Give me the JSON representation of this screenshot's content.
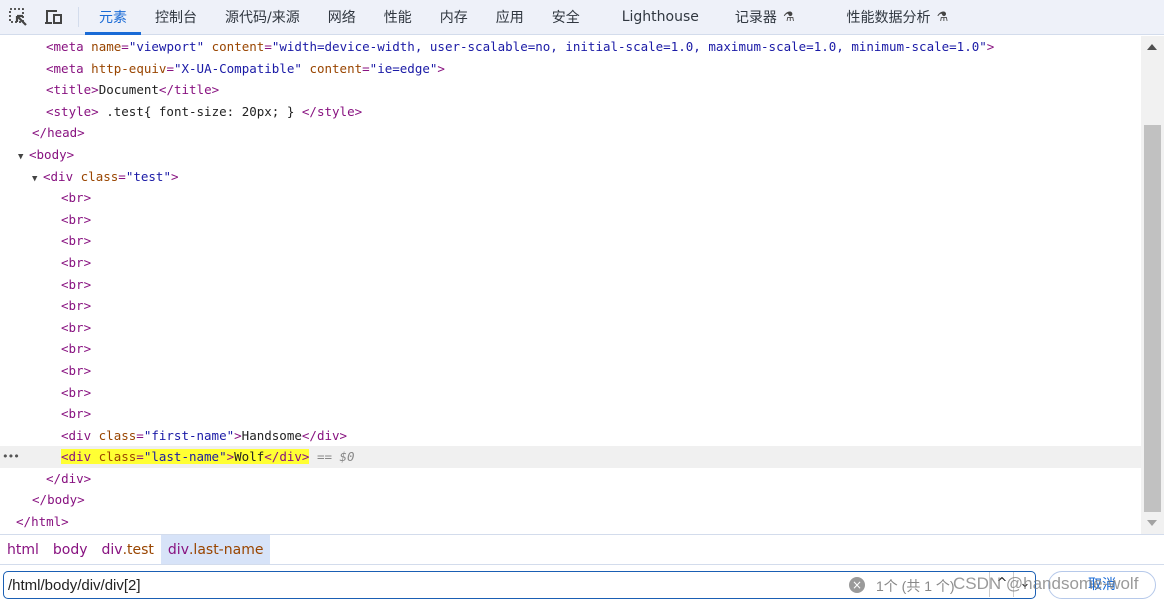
{
  "toolbar": {
    "icons": [
      "inspect-element-icon",
      "device-toolbar-icon"
    ],
    "tabs": [
      {
        "label": "元素",
        "active": true
      },
      {
        "label": "控制台"
      },
      {
        "label": "源代码/来源"
      },
      {
        "label": "网络"
      },
      {
        "label": "性能"
      },
      {
        "label": "内存"
      },
      {
        "label": "应用"
      },
      {
        "label": "安全"
      },
      {
        "label": "Lighthouse"
      },
      {
        "label": "记录器",
        "experimental": true
      },
      {
        "label": "性能数据分析",
        "experimental": true
      }
    ],
    "flask_glyph": "⚗"
  },
  "dom_tree": {
    "meta_viewport": {
      "tag": "meta",
      "attr1": "name",
      "val1": "viewport",
      "attr2": "content",
      "val2": "width=device-width, user-scalable=no, initial-scale=1.0, maximum-scale=1.0, minimum-scale=1.0"
    },
    "meta_compat": {
      "tag": "meta",
      "attr1": "http-equiv",
      "val1": "X-UA-Compatible",
      "attr2": "content",
      "val2": "ie=edge"
    },
    "title": {
      "tag": "title",
      "text": "Document"
    },
    "style": {
      "tag": "style",
      "text": " .test{ font-size: 20px; } "
    },
    "head_close": "head",
    "body_open": "body",
    "div_test": {
      "tag": "div",
      "attr": "class",
      "val": "test"
    },
    "br_tag": "br",
    "br_count": 11,
    "first_name": {
      "tag": "div",
      "attr": "class",
      "val": "first-name",
      "text": "Handsome"
    },
    "last_name": {
      "tag": "div",
      "attr": "class",
      "val": "last-name",
      "text": "Wolf",
      "console_ref": "== $0"
    },
    "div_close": "div",
    "body_close": "body",
    "html_close": "html",
    "selected_dots": "•••"
  },
  "breadcrumbs": [
    {
      "tag": "html",
      "cls": ""
    },
    {
      "tag": "body",
      "cls": ""
    },
    {
      "tag": "div",
      "cls": ".test"
    },
    {
      "tag": "div",
      "cls": ".last-name",
      "active": true
    }
  ],
  "search": {
    "value": "/html/body/div/div[2]",
    "match_count": "1个 (共 1 个)",
    "prev_label": "^",
    "next_label": "⌄",
    "clear_label": "×",
    "cancel_label": "取消"
  },
  "watermark": "CSDN @handsome-wolf"
}
